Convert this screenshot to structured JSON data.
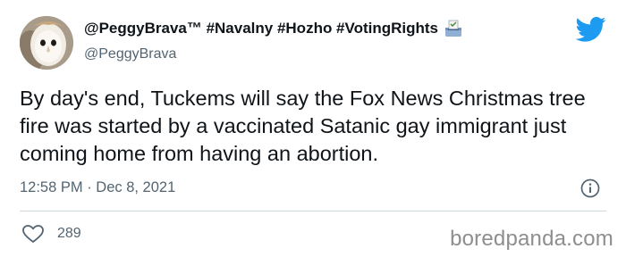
{
  "user": {
    "display_name": "@PeggyBrava™ #Navalny #Hozho #VotingRights",
    "handle": "@PeggyBrava",
    "avatar_icon": "barn-owl-avatar",
    "name_badge_icon": "ballot-box-icon"
  },
  "tweet": {
    "text": "By day's end, Tuckems will say the Fox News Christmas tree fire was started by a vaccinated Satanic gay immigrant just coming home from having an abortion.",
    "timestamp": "12:58 PM · Dec 8, 2021"
  },
  "actions": {
    "like_count": "289",
    "like_icon": "heart-icon",
    "info_icon": "info-icon"
  },
  "brand": {
    "logo_icon": "twitter-bird-icon",
    "watermark": "boredpanda.com"
  },
  "colors": {
    "text": "#0f1419",
    "secondary": "#536471",
    "twitter_blue": "#1d9bf0",
    "divider": "#cfd9de"
  }
}
